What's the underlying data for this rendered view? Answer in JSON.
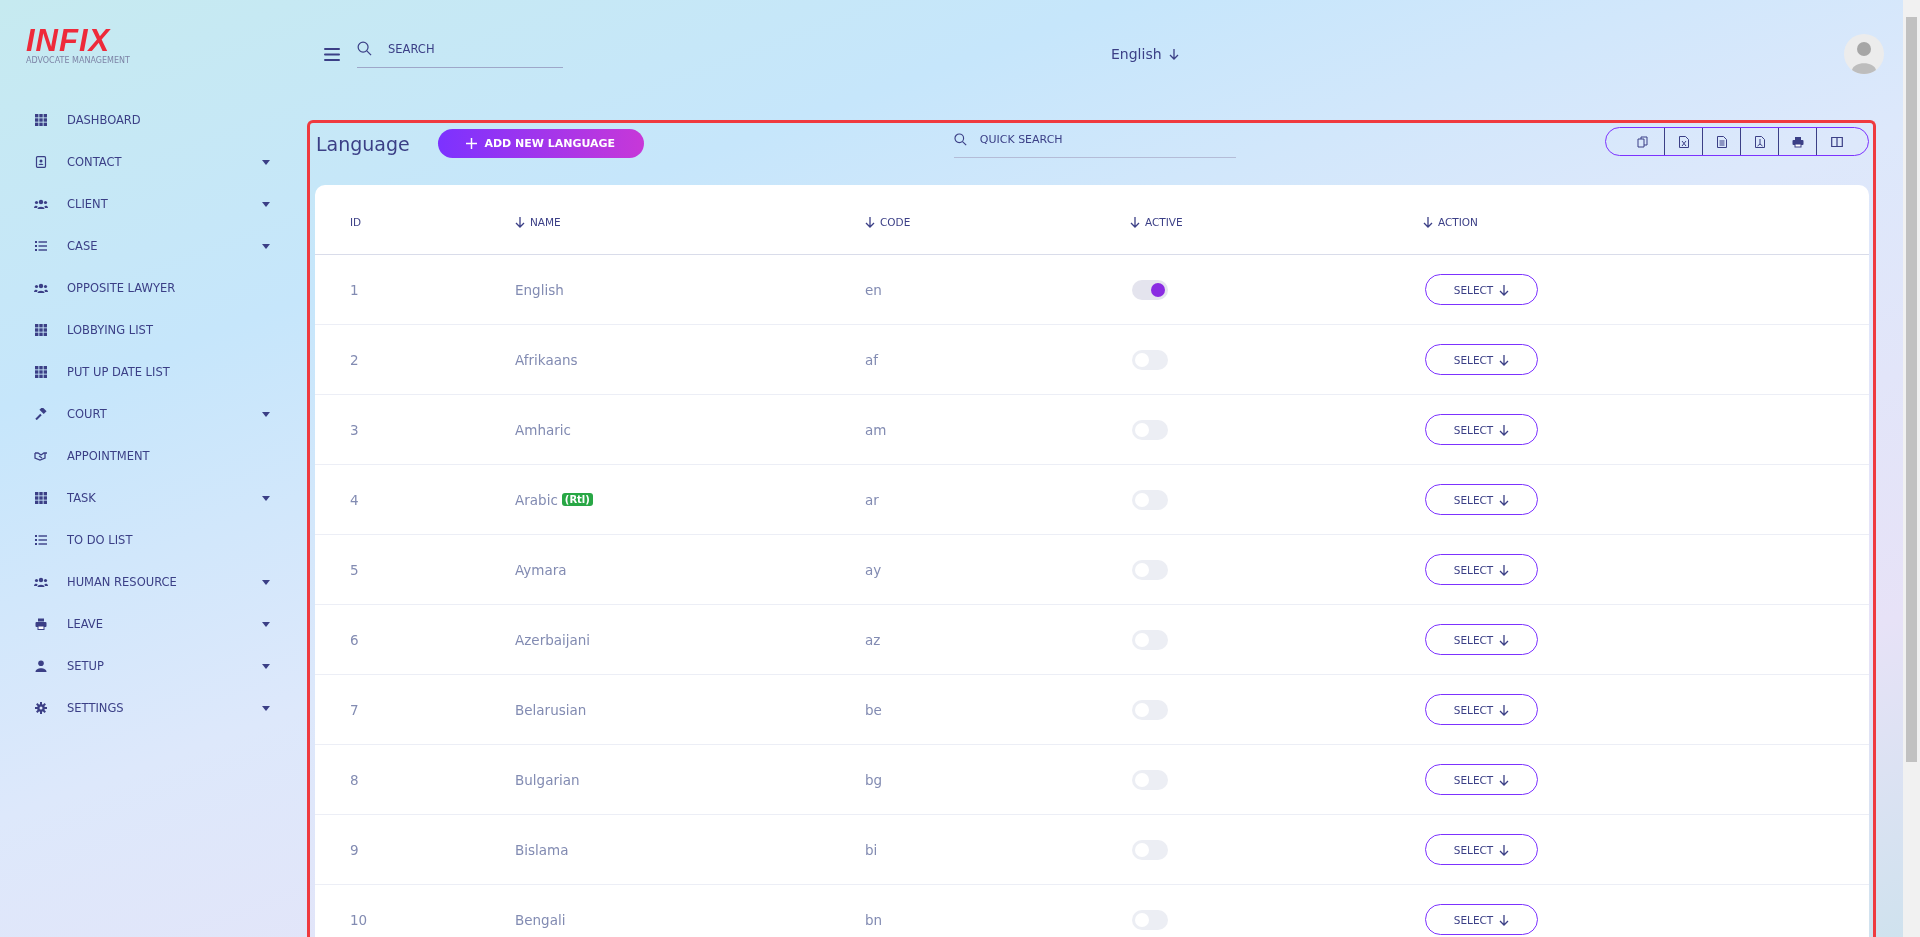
{
  "logo": {
    "wordmark": "INFIX",
    "tagline": "ADVOCATE MANAGEMENT"
  },
  "topbar": {
    "search": {
      "placeholder": "SEARCH"
    },
    "language": "English"
  },
  "sidebar": {
    "items": [
      {
        "label": "DASHBOARD",
        "expandable": false
      },
      {
        "label": "CONTACT",
        "expandable": true
      },
      {
        "label": "CLIENT",
        "expandable": true
      },
      {
        "label": "CASE",
        "expandable": true
      },
      {
        "label": "OPPOSITE LAWYER",
        "expandable": false
      },
      {
        "label": "LOBBYING LIST",
        "expandable": false
      },
      {
        "label": "PUT UP DATE LIST",
        "expandable": false
      },
      {
        "label": "COURT",
        "expandable": true
      },
      {
        "label": "APPOINTMENT",
        "expandable": false
      },
      {
        "label": "TASK",
        "expandable": true
      },
      {
        "label": "TO DO LIST",
        "expandable": false
      },
      {
        "label": "HUMAN RESOURCE",
        "expandable": true
      },
      {
        "label": "LEAVE",
        "expandable": true
      },
      {
        "label": "SETUP",
        "expandable": true
      },
      {
        "label": "SETTINGS",
        "expandable": true
      }
    ]
  },
  "page": {
    "title": "Language",
    "add_button": "ADD NEW LANGUAGE",
    "quick_search": {
      "placeholder": "QUICK SEARCH"
    }
  },
  "table": {
    "columns": [
      {
        "label": "ID",
        "sortable": false
      },
      {
        "label": "NAME",
        "sortable": true
      },
      {
        "label": "CODE",
        "sortable": true
      },
      {
        "label": "ACTIVE",
        "sortable": true
      },
      {
        "label": "ACTION",
        "sortable": true
      }
    ],
    "rows": [
      {
        "id": "1",
        "name": "English",
        "code": "en",
        "active": true,
        "action": "SELECT"
      },
      {
        "id": "2",
        "name": "Afrikaans",
        "code": "af",
        "active": false,
        "action": "SELECT"
      },
      {
        "id": "3",
        "name": "Amharic",
        "code": "am",
        "active": false,
        "action": "SELECT"
      },
      {
        "id": "4",
        "name": "Arabic",
        "badge": "(Rtl)",
        "code": "ar",
        "active": false,
        "action": "SELECT"
      },
      {
        "id": "5",
        "name": "Aymara",
        "code": "ay",
        "active": false,
        "action": "SELECT"
      },
      {
        "id": "6",
        "name": "Azerbaijani",
        "code": "az",
        "active": false,
        "action": "SELECT"
      },
      {
        "id": "7",
        "name": "Belarusian",
        "code": "be",
        "active": false,
        "action": "SELECT"
      },
      {
        "id": "8",
        "name": "Bulgarian",
        "code": "bg",
        "active": false,
        "action": "SELECT"
      },
      {
        "id": "9",
        "name": "Bislama",
        "code": "bi",
        "active": false,
        "action": "SELECT"
      },
      {
        "id": "10",
        "name": "Bengali",
        "code": "bn",
        "active": false,
        "action": "SELECT"
      }
    ]
  }
}
